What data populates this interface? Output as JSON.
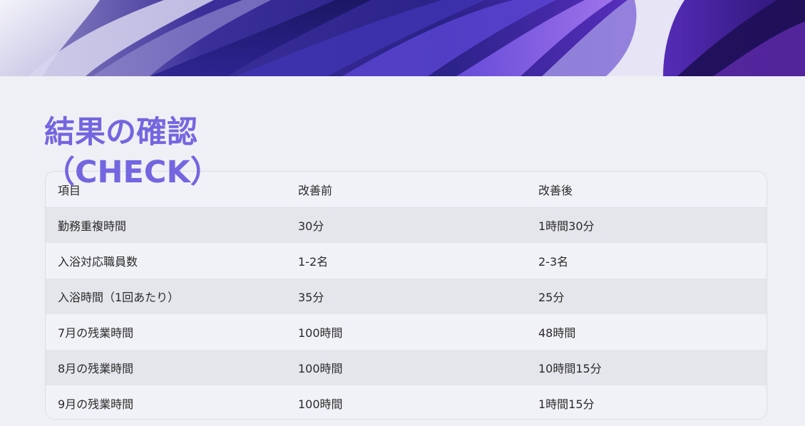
{
  "slide": {
    "title_line1": "結果の確認",
    "title_line2": "（CHECK）"
  },
  "colors": {
    "title": "#7366e0",
    "background": "#eff0f5",
    "row_shaded": "#e5e6eb"
  },
  "table": {
    "headers": [
      "項目",
      "改善前",
      "改善後"
    ],
    "rows": [
      [
        "勤務重複時間",
        "30分",
        "1時間30分"
      ],
      [
        "入浴対応職員数",
        "1-2名",
        "2-3名"
      ],
      [
        "入浴時間（1回あたり）",
        "35分",
        "25分"
      ],
      [
        "7月の残業時間",
        "100時間",
        "48時間"
      ],
      [
        "8月の残業時間",
        "100時間",
        "10時間15分"
      ],
      [
        "9月の残業時間",
        "100時間",
        "1時間15分"
      ]
    ]
  }
}
